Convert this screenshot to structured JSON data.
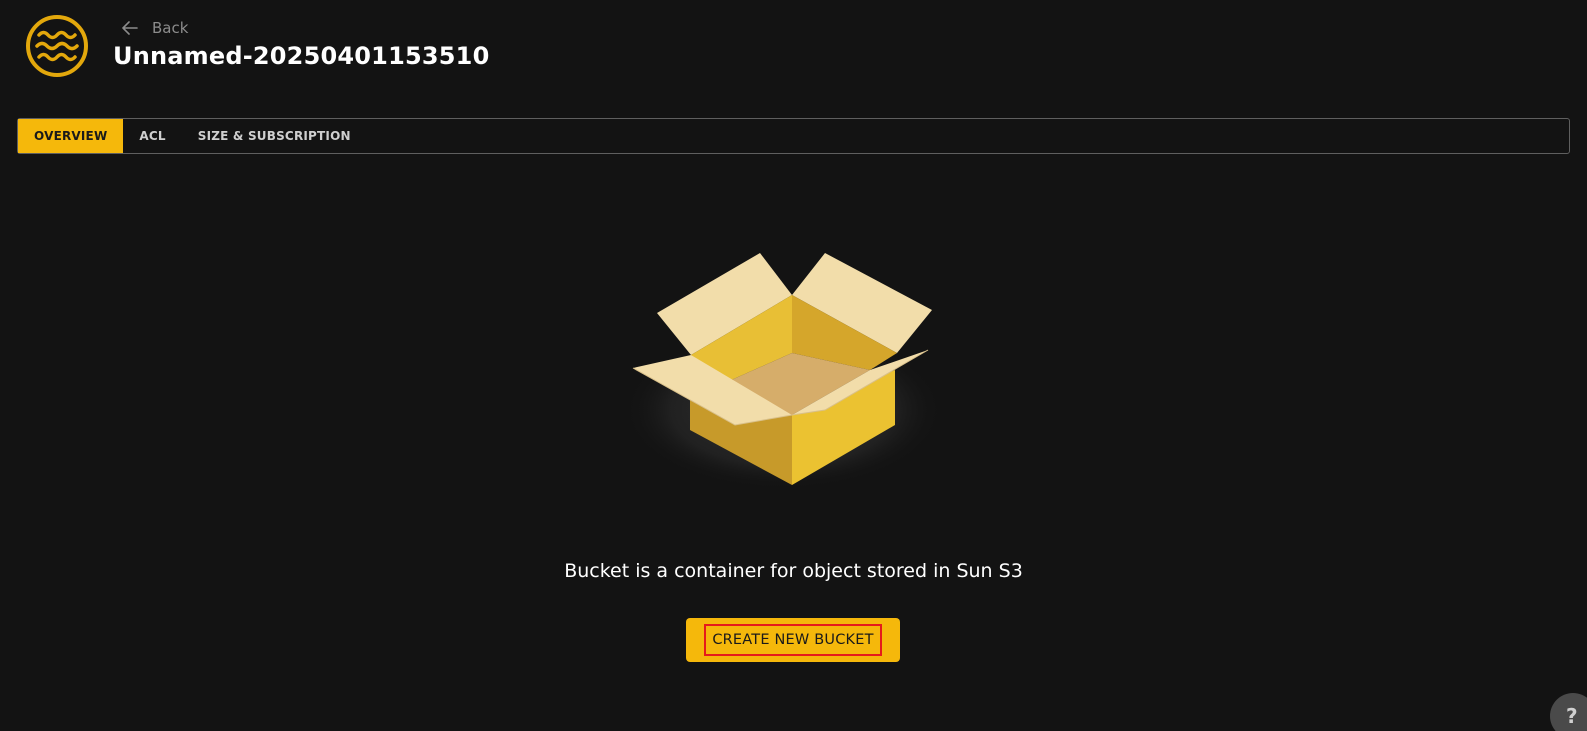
{
  "header": {
    "back_label": "Back",
    "title": "Unnamed-20250401153510"
  },
  "tabs": [
    {
      "label": "OVERVIEW",
      "active": true
    },
    {
      "label": "ACL",
      "active": false
    },
    {
      "label": "SIZE & SUBSCRIPTION",
      "active": false
    }
  ],
  "main": {
    "message": "Bucket is a container for object stored in Sun S3",
    "create_button_label": "CREATE NEW BUCKET"
  },
  "help": {
    "label": "?"
  },
  "colors": {
    "accent": "#f5b80b",
    "background": "#131313",
    "focus_outline": "#e51b1b"
  },
  "icons": {
    "logo": "waves-circle-logo",
    "back": "arrow-left-icon",
    "illustration": "open-box-illustration"
  }
}
